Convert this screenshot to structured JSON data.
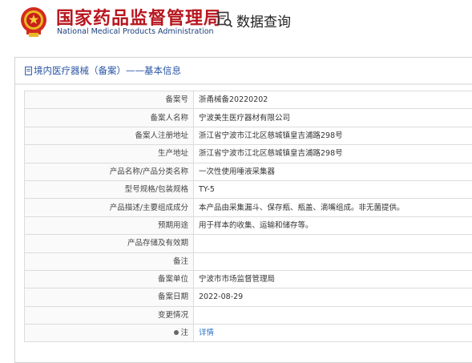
{
  "header": {
    "brand_cn": "国家药品监督管理局",
    "brand_en": "National Medical Products Administration",
    "query_label": "数据查询",
    "accent_red": "#b8161e",
    "accent_blue": "#1a3f7a"
  },
  "panel": {
    "title": "境内医疗器械（备案）——基本信息"
  },
  "rows": [
    {
      "label": "备案号",
      "value": "浙甬械备20220202"
    },
    {
      "label": "备案人名称",
      "value": "宁波美生医疗器材有限公司"
    },
    {
      "label": "备案人注册地址",
      "value": "浙江省宁波市江北区慈城镇皇吉浦路298号"
    },
    {
      "label": "生产地址",
      "value": "浙江省宁波市江北区慈城镇皇吉浦路298号"
    },
    {
      "label": "产品名称/产品分类名称",
      "value": "一次性使用唾液采集器"
    },
    {
      "label": "型号规格/包装规格",
      "value": "TY-5"
    },
    {
      "label": "产品描述/主要组成成分",
      "value": "本产品由采集漏斗、保存瓶、瓶盖、滴嘴组成。非无菌提供。"
    },
    {
      "label": "预期用途",
      "value": "用于样本的收集、运输和储存等。"
    },
    {
      "label": "产品存储及有效期",
      "value": ""
    },
    {
      "label": "备注",
      "value": ""
    },
    {
      "label": "备案单位",
      "value": "宁波市市场监督管理局"
    },
    {
      "label": "备案日期",
      "value": "2022-08-29"
    },
    {
      "label": "变更情况",
      "value": ""
    },
    {
      "label": "注",
      "value": "详情"
    }
  ]
}
